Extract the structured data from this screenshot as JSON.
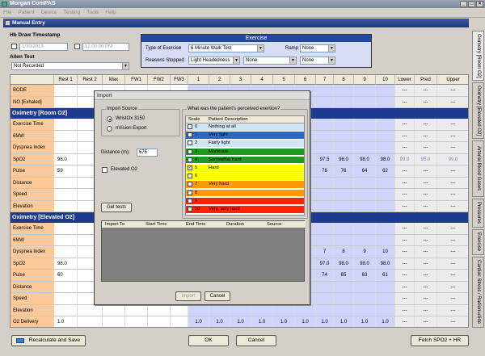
{
  "app": {
    "title": "Morgan ComPAS"
  },
  "menu": [
    "File",
    "Patient",
    "Device",
    "Testing",
    "Tools",
    "Help"
  ],
  "window": {
    "title": "Manual Entry"
  },
  "hb": {
    "label": "Hb Draw Timestamp",
    "date": "1/30/2013",
    "time": "12:00:00 PM"
  },
  "allen": {
    "label": "Allen Test",
    "value": "Not Recorded"
  },
  "exercise": {
    "header": "Exercise",
    "type_label": "Type of Exercise",
    "type_value": "6 Minute Walk Test",
    "ramp_label": "Ramp",
    "ramp_value": "None",
    "reasons_label": "Reasons Stopped",
    "reason1": "Light Headedness",
    "reason2": "None",
    "reason3": "None"
  },
  "side_tabs": [
    "Oximetry [Room O2]",
    "Oximetry [Elevated O2]",
    "Arterial Blood Gases",
    "Pressures",
    "Exercise",
    "Cardiac Stress / Radionuclide"
  ],
  "columns": [
    "Rest 1",
    "Rest 2",
    "Max",
    "FW1",
    "FW2",
    "FW3",
    "1",
    "2",
    "3",
    "4",
    "5",
    "6",
    "7",
    "8",
    "9",
    "10",
    "Lower",
    "Pred",
    "Upper"
  ],
  "rows_top": [
    {
      "label": "BODE",
      "right": [
        "---",
        "---",
        "---"
      ]
    },
    {
      "label": "NO [Exhaled]",
      "right": [
        "---",
        "---",
        "---"
      ]
    }
  ],
  "section1": {
    "title": "Oximetry [Room O2]",
    "rows": [
      {
        "label": "Exercise Time",
        "rest1": "",
        "vals": [
          "",
          "",
          "",
          ""
        ],
        "right": [
          "---",
          "---",
          "---"
        ]
      },
      {
        "label": "6MW",
        "rest1": "",
        "vals": [
          "",
          "",
          "",
          ""
        ],
        "right": [
          "---",
          "---",
          "---"
        ]
      },
      {
        "label": "Dyspnea Index",
        "rest1": "",
        "vals": [
          "",
          "",
          "",
          ""
        ],
        "right": [
          "---",
          "---",
          "---"
        ]
      },
      {
        "label": "SpO2",
        "rest1": "98.0",
        "vals": [
          "97.5",
          "98.0",
          "98.0",
          "98.0"
        ],
        "right": [
          "99.0",
          "95.0",
          "99.0"
        ]
      },
      {
        "label": "Pulse",
        "rest1": "59",
        "vals": [
          "76",
          "76",
          "64",
          "62"
        ],
        "right": [
          "---",
          "---",
          "---"
        ]
      },
      {
        "label": "Distance",
        "rest1": "",
        "vals": [
          "",
          "",
          "",
          ""
        ],
        "right": [
          "---",
          "---",
          "---"
        ]
      },
      {
        "label": "Speed",
        "rest1": "",
        "vals": [
          "",
          "",
          "",
          ""
        ],
        "right": [
          "---",
          "---",
          "---"
        ]
      },
      {
        "label": "Elevation",
        "rest1": "",
        "vals": [
          "",
          "",
          "",
          ""
        ],
        "right": [
          "---",
          "---",
          "---"
        ]
      }
    ]
  },
  "section2": {
    "title": "Oximetry [Elevated O2]",
    "rows": [
      {
        "label": "Exercise Time",
        "rest1": "",
        "vals": [
          "",
          "",
          "",
          ""
        ],
        "right": [
          "---",
          "---",
          "---"
        ]
      },
      {
        "label": "6MW",
        "rest1": "",
        "vals": [
          "",
          "",
          "",
          ""
        ],
        "right": [
          "---",
          "---",
          "---"
        ]
      },
      {
        "label": "Dyspnea Index",
        "rest1": "",
        "vals": [
          "7",
          "8",
          "9",
          "10"
        ],
        "right": [
          "---",
          "---",
          "---"
        ]
      },
      {
        "label": "SpO2",
        "rest1": "98.0",
        "vals": [
          "97.0",
          "98.0",
          "98.0",
          "98.0"
        ],
        "right": [
          "---",
          "---",
          "---"
        ]
      },
      {
        "label": "Pulse",
        "rest1": "60",
        "vals": [
          "74",
          "65",
          "63",
          "61"
        ],
        "right": [
          "---",
          "---",
          "---"
        ]
      },
      {
        "label": "Distance",
        "rest1": "",
        "vals": [
          "",
          "",
          "",
          ""
        ],
        "right": [
          "---",
          "---",
          "---"
        ]
      },
      {
        "label": "Speed",
        "rest1": "",
        "vals": [
          "",
          "",
          "",
          ""
        ],
        "right": [
          "---",
          "---",
          "---"
        ]
      },
      {
        "label": "Elevation",
        "rest1": "",
        "vals": [
          "",
          "",
          "",
          ""
        ],
        "right": [
          "---",
          "---",
          "---"
        ]
      },
      {
        "label": "O2 Delivery",
        "rest1": "1.0",
        "vals": [
          "1.0",
          "1.0",
          "1.0",
          "1.0"
        ],
        "right": [
          "---",
          "---",
          "---"
        ],
        "left_vals": [
          "1.0",
          "1.0",
          "1.0",
          "1.0",
          "1.0",
          "1.0"
        ]
      }
    ]
  },
  "import": {
    "title": "Import",
    "source_label": "Import Source",
    "source1": "WristOx 3150",
    "source2": "nVision Export",
    "distance_label": "Distance (m):",
    "distance_value": "675",
    "elevated_label": "Elevated O2",
    "get_tests": "Get tests",
    "question": "What was the patient's perceived exertion?",
    "scale_header": "Scale",
    "desc_header": "Patient Description",
    "scale": [
      {
        "n": "0",
        "d": "Nothing at all",
        "color": "#cfe6f7",
        "checked": false
      },
      {
        "n": "1",
        "d": "Very light",
        "color": "#2c68c8",
        "checked": false
      },
      {
        "n": "2",
        "d": "Fairly light",
        "color": "#cfe6f7",
        "checked": false
      },
      {
        "n": "3",
        "d": "Moderate",
        "color": "#1f9a1f",
        "checked": false
      },
      {
        "n": "4",
        "d": "Somewhat hard",
        "color": "#1f9a1f",
        "checked": false
      },
      {
        "n": "5",
        "d": "Hard",
        "color": "#ffff00",
        "checked": true
      },
      {
        "n": "6",
        "d": "",
        "color": "#ffff00",
        "checked": false
      },
      {
        "n": "7",
        "d": "Very hard",
        "color": "#ff9a00",
        "checked": false
      },
      {
        "n": "8",
        "d": "",
        "color": "#ff9a00",
        "checked": false
      },
      {
        "n": "9",
        "d": "",
        "color": "#ff2400",
        "checked": false
      },
      {
        "n": "10",
        "d": "Very, very hard",
        "color": "#ff2400",
        "checked": false
      }
    ],
    "table_headers": [
      "Import To",
      "Start Time",
      "End Time",
      "Duration",
      "Source"
    ],
    "import_btn": "Import",
    "cancel_btn": "Cancel"
  },
  "footer": {
    "recalc": "Recalculate and Save",
    "ok": "OK",
    "cancel": "Cancel",
    "fetch": "Fetch SPO2 + HR"
  }
}
